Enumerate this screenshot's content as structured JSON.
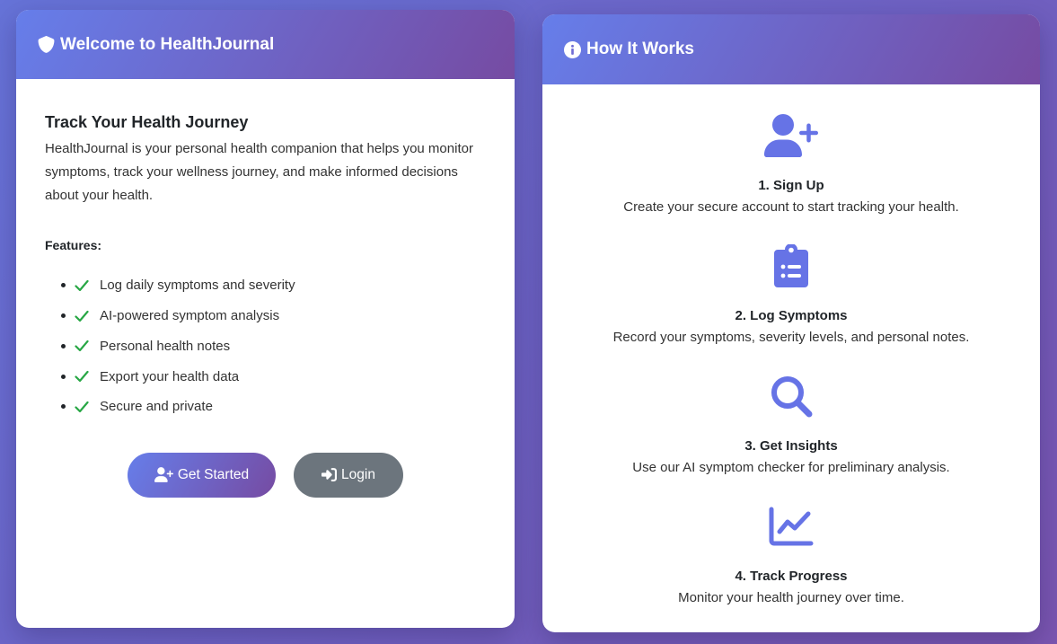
{
  "welcome": {
    "header_title": "Welcome to HealthJournal",
    "subtitle": "Track Your Health Journey",
    "intro": "HealthJournal is your personal health companion that helps you monitor symptoms, track your wellness journey, and make informed decisions about your health.",
    "features_label": "Features:",
    "features": [
      {
        "label": "Log daily symptoms and severity"
      },
      {
        "label": "AI-powered symptom analysis"
      },
      {
        "label": "Personal health notes"
      },
      {
        "label": "Export your health data"
      },
      {
        "label": "Secure and private"
      }
    ],
    "get_started_label": "Get Started",
    "login_label": "Login"
  },
  "how": {
    "header_title": "How It Works",
    "steps": [
      {
        "icon": "user-plus-icon",
        "title": "1. Sign Up",
        "desc": "Create your secure account to start tracking your health."
      },
      {
        "icon": "clipboard-list-icon",
        "title": "2. Log Symptoms",
        "desc": "Record your symptoms, severity levels, and personal notes."
      },
      {
        "icon": "search-icon",
        "title": "3. Get Insights",
        "desc": "Use our AI symptom checker for preliminary analysis."
      },
      {
        "icon": "chart-line-icon",
        "title": "4. Track Progress",
        "desc": "Monitor your health journey over time."
      }
    ]
  },
  "colors": {
    "accent_start": "#667eea",
    "accent_end": "#764ba2",
    "icon": "#6673e6",
    "check": "#28a745",
    "secondary_button": "#6c757d"
  }
}
